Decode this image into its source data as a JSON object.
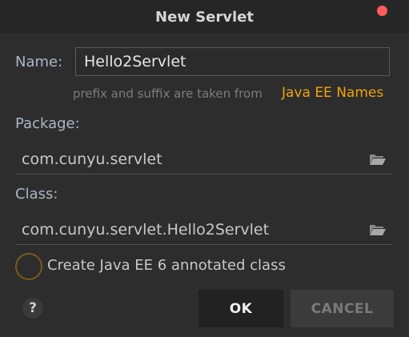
{
  "dialog": {
    "title": "New Servlet"
  },
  "name": {
    "label": "Name:",
    "value": "Hello2Servlet",
    "hint": "prefix and suffix are taken from",
    "hint_link": "Java EE Names"
  },
  "package": {
    "label": "Package:",
    "value": "com.cunyu.servlet",
    "icon": "folder-open-icon"
  },
  "class": {
    "label": "Class:",
    "value": "com.cunyu.servlet.Hello2Servlet",
    "icon": "folder-open-icon"
  },
  "annotation": {
    "label": "Create Java EE 6 annotated class",
    "checked": false
  },
  "footer": {
    "help_label": "?",
    "ok_label": "OK",
    "cancel_label": "CANCEL"
  },
  "colors": {
    "accent": "#f0a30a",
    "close": "#ff5b5b",
    "background": "#2d2d2d"
  }
}
